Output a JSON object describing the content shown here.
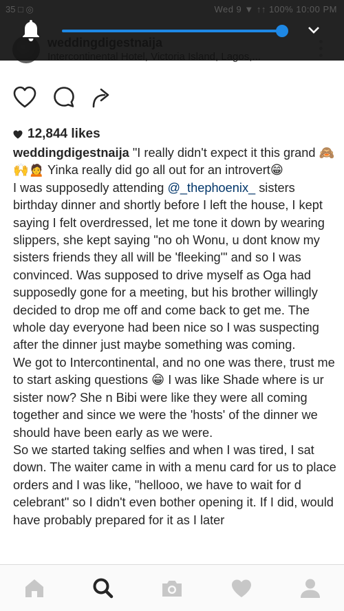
{
  "status_bar": {
    "left_text": "35 □ ◎",
    "right_text": "Wed 9 ▼ ↑↑ 100% 10:00 PM"
  },
  "volume_panel": {
    "icon": "bell-icon",
    "level_fraction": 0.97,
    "accent_color": "#1e88e5"
  },
  "post": {
    "username": "weddingdigestnaija",
    "location": "Intercontinental Hotel, Victoria Island, Lagos,..."
  },
  "actions": {
    "like_icon": "heart-outline-icon",
    "comment_icon": "comment-icon",
    "share_icon": "share-arrow-icon"
  },
  "likes": {
    "text": "12,844 likes"
  },
  "caption": {
    "username": "weddingdigestnaija",
    "part1": " \"I really didn't expect it this grand 🙈🙌🙍 Yinka really did go all out for an introvert😁",
    "part2a": "I was supposedly attending ",
    "mention": "@_thephoenix_",
    "part2b": " sisters birthday dinner and shortly before I left the house, I kept saying I felt overdressed, let me tone it down by wearing slippers, she kept saying \"no oh Wonu, u dont know my sisters friends they all will be 'fleeking'\" and so I was convinced. Was supposed to drive myself as Oga had supposedly gone for a meeting, but his brother willingly decided to drop me off and come back to get me. The whole day everyone had been nice so I was suspecting after the dinner just maybe something was coming.",
    "part3": "We got to Intercontinental, and no one was there, trust me to start asking questions 😁 I was like Shade where is ur sister now? She n Bibi were like they were all coming together and since we were the 'hosts' of the dinner we should have been early as we were.",
    "part4": "So we started taking selfies and when I was tired, I sat down. The waiter came in with a menu card for us to place orders and I was like, \"hellooo, we have to wait for d celebrant\" so I didn't even bother opening it. If I did, would have probably prepared for it as I later"
  },
  "bottom_nav": {
    "items": [
      "home-icon",
      "search-icon",
      "camera-icon",
      "heart-icon",
      "profile-icon"
    ],
    "active": "search-icon"
  }
}
